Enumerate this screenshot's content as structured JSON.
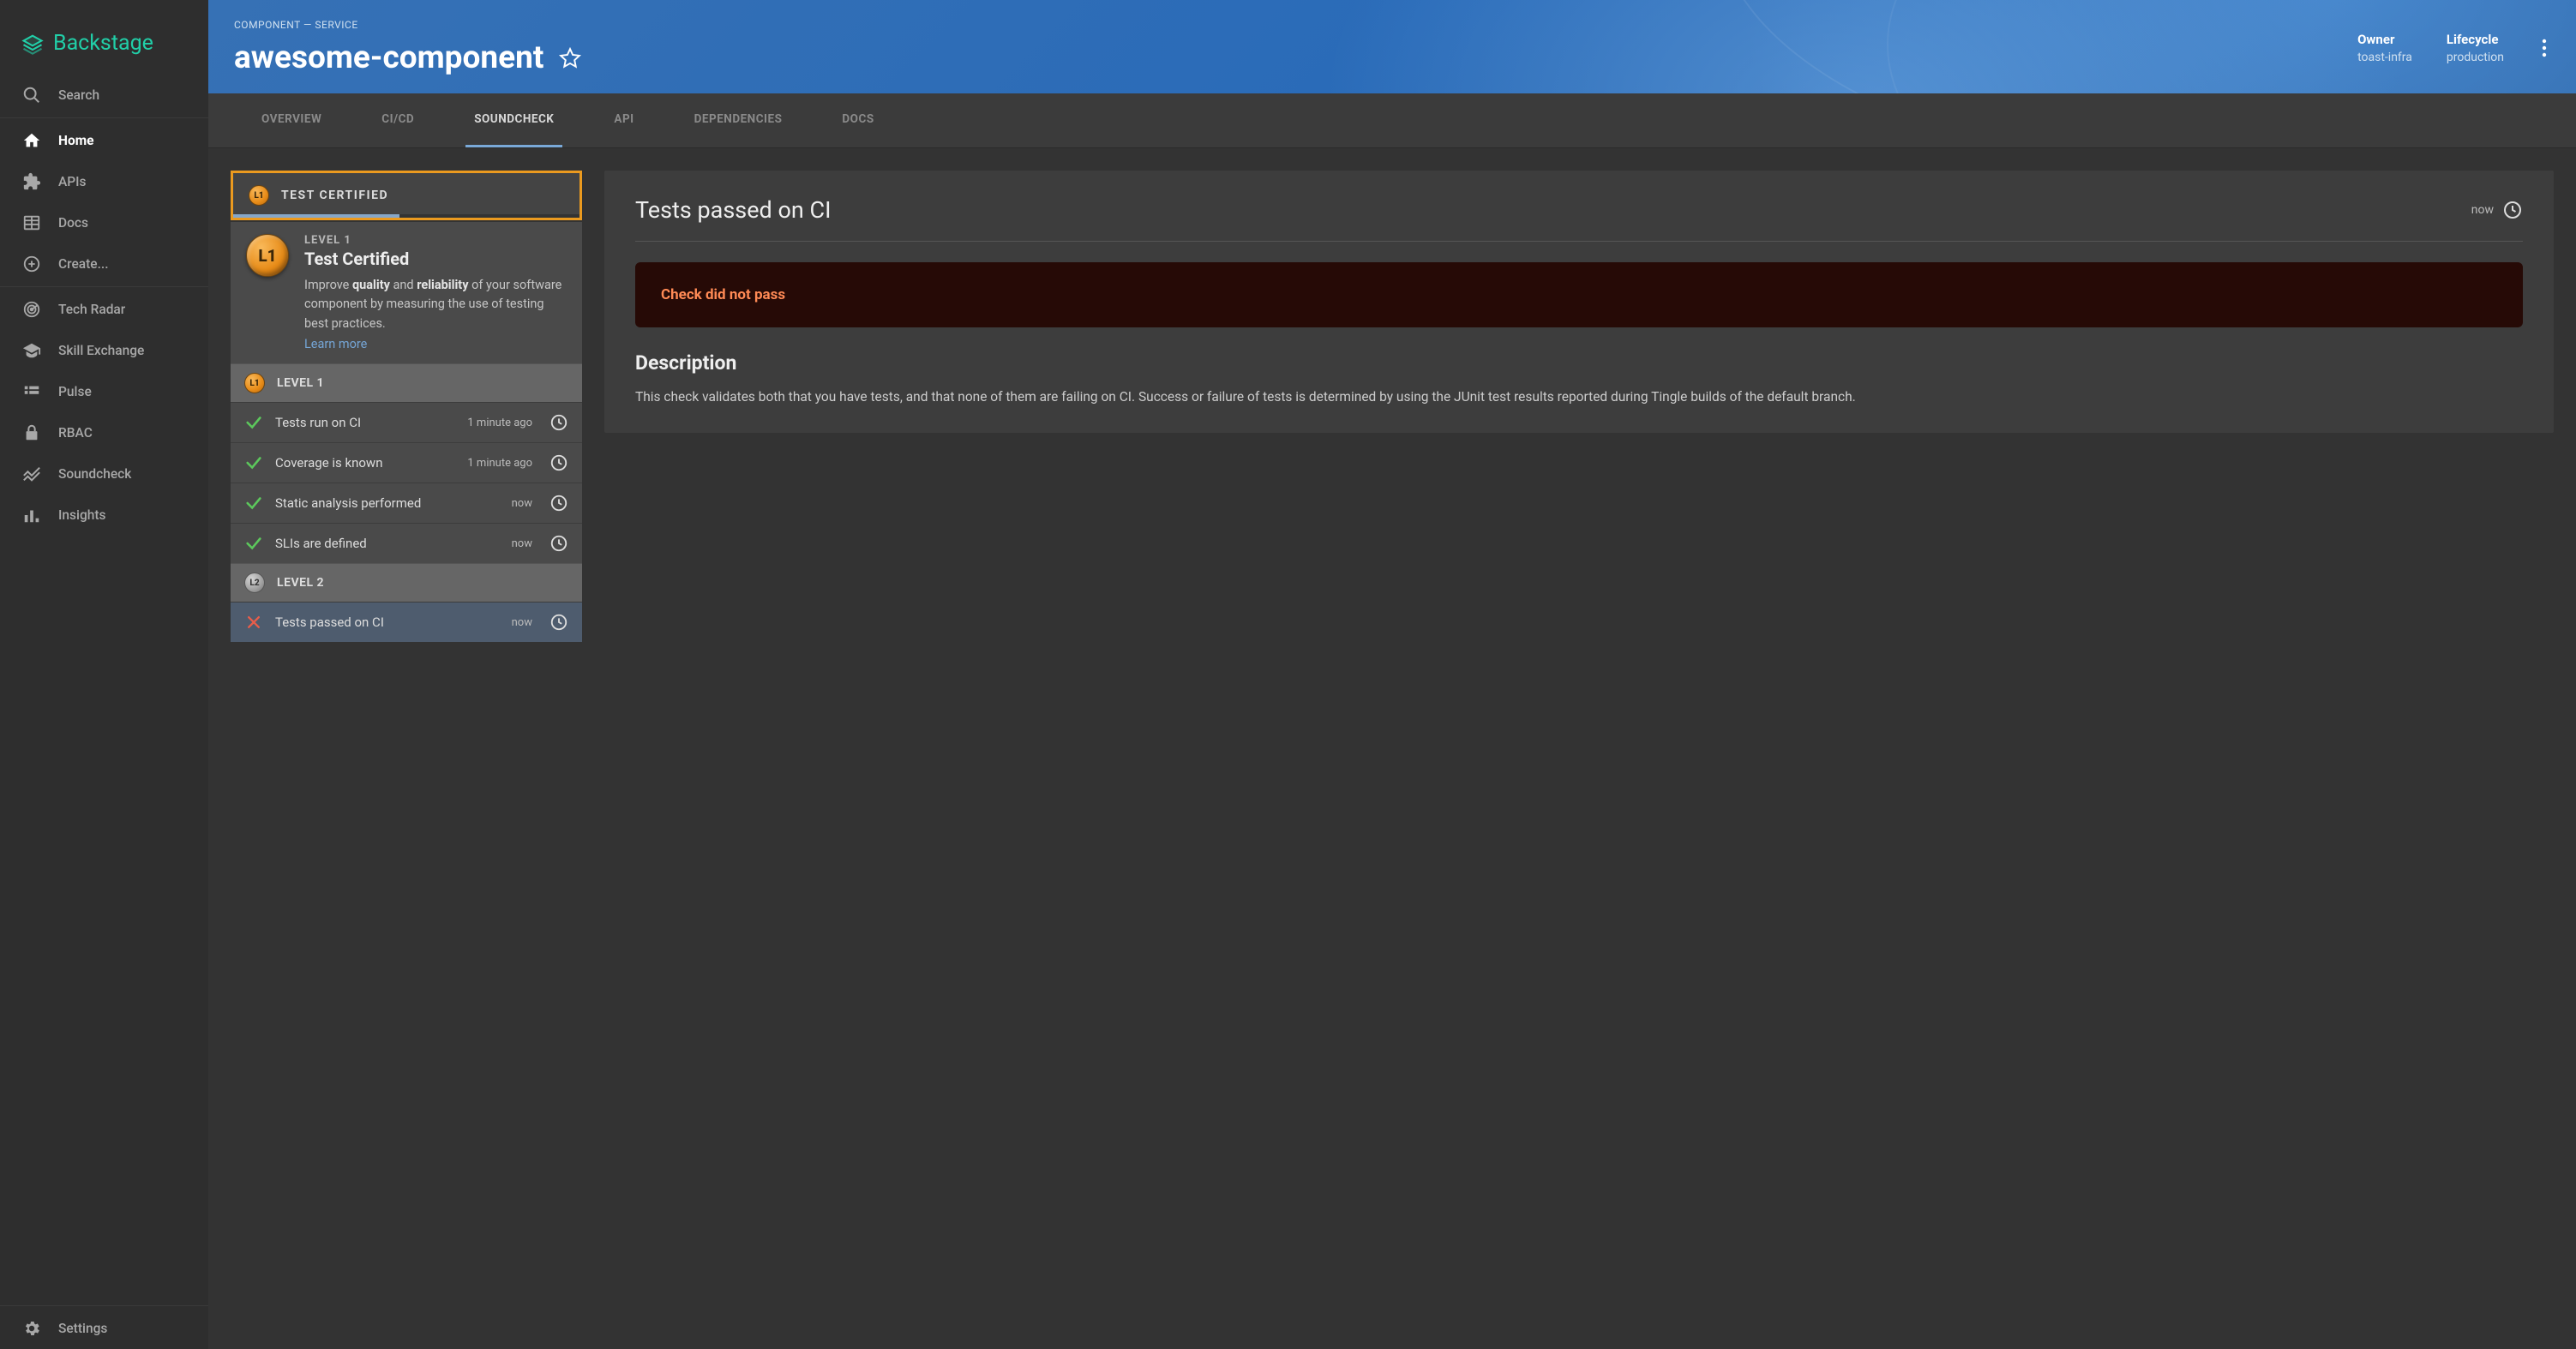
{
  "brand": "Backstage",
  "sidebar": {
    "search_label": "Search",
    "home_label": "Home",
    "apis_label": "APIs",
    "docs_label": "Docs",
    "create_label": "Create...",
    "tech_radar_label": "Tech Radar",
    "skill_exchange_label": "Skill Exchange",
    "pulse_label": "Pulse",
    "rbac_label": "RBAC",
    "soundcheck_label": "Soundcheck",
    "insights_label": "Insights",
    "settings_label": "Settings"
  },
  "header": {
    "breadcrumb": "COMPONENT — SERVICE",
    "title": "awesome-component",
    "owner_label": "Owner",
    "owner_value": "toast-infra",
    "lifecycle_label": "Lifecycle",
    "lifecycle_value": "production"
  },
  "tabs": {
    "overview": "OVERVIEW",
    "cicd": "CI/CD",
    "soundcheck": "SOUNDCHECK",
    "api": "API",
    "dependencies": "DEPENDENCIES",
    "docs": "DOCS"
  },
  "track": {
    "badge": "L1",
    "label": "TEST CERTIFIED",
    "progress_pct": 48
  },
  "overview_card": {
    "badge": "L1",
    "level_label": "LEVEL 1",
    "title": "Test Certified",
    "desc_pre": "Improve ",
    "desc_b1": "quality",
    "desc_mid": " and ",
    "desc_b2": "reliability",
    "desc_post": " of your software component by measuring the use of testing best practices.",
    "learn_more": "Learn more"
  },
  "levels": [
    {
      "badge": "L1",
      "badge_style": "orange",
      "label": "LEVEL 1",
      "checks": [
        {
          "status": "pass",
          "label": "Tests run on CI",
          "time": "1 minute ago",
          "selected": false
        },
        {
          "status": "pass",
          "label": "Coverage is known",
          "time": "1 minute ago",
          "selected": false
        },
        {
          "status": "pass",
          "label": "Static analysis performed",
          "time": "now",
          "selected": false
        },
        {
          "status": "pass",
          "label": "SLIs are defined",
          "time": "now",
          "selected": false
        }
      ]
    },
    {
      "badge": "L2",
      "badge_style": "gray",
      "label": "LEVEL 2",
      "checks": [
        {
          "status": "fail",
          "label": "Tests passed on CI",
          "time": "now",
          "selected": true
        }
      ]
    }
  ],
  "detail": {
    "title": "Tests passed on CI",
    "time": "now",
    "alert": "Check did not pass",
    "desc_heading": "Description",
    "desc_body": "This check validates both that you have tests, and that none of them are failing on CI. Success or failure of tests is determined by using the JUnit test results reported during Tingle builds of the default branch."
  }
}
